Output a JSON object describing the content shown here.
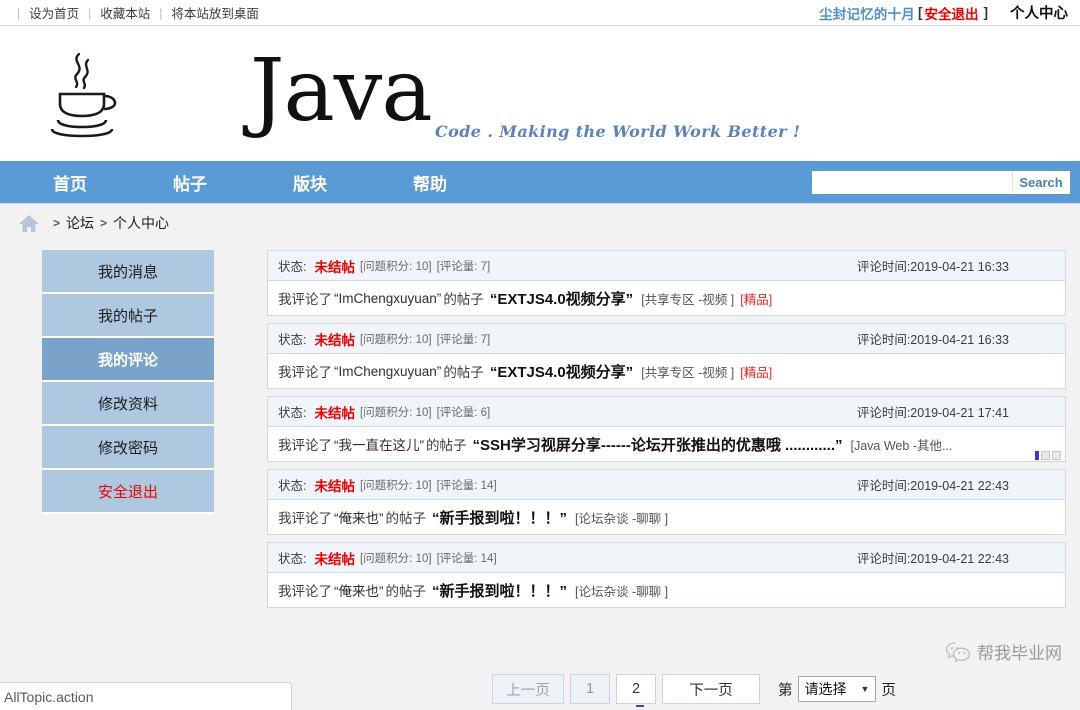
{
  "topbar": {
    "links": [
      "设为首页",
      "收藏本站",
      "将本站放到桌面"
    ],
    "separator": "|",
    "username": "尘封记忆的十月",
    "bracket_left": "[",
    "logout": "安全退出",
    "bracket_right": "]",
    "personal_center": "个人中心"
  },
  "banner": {
    "logo_text": "Java",
    "tagline": "Code . Making the World Work Better !"
  },
  "nav": {
    "items": [
      "首页",
      "帖子",
      "版块",
      "帮助"
    ],
    "search_value": "",
    "search_placeholder": "",
    "search_button": "Search",
    "bg_color": "#5b9bd5"
  },
  "breadcrumb": {
    "home_icon": "home-icon",
    "sep": ">",
    "items": [
      "论坛",
      "个人中心"
    ]
  },
  "sidebar": {
    "items": [
      {
        "label": "我的消息",
        "active": false,
        "danger": false
      },
      {
        "label": "我的帖子",
        "active": false,
        "danger": false
      },
      {
        "label": "我的评论",
        "active": true,
        "danger": false
      },
      {
        "label": "修改资料",
        "active": false,
        "danger": false
      },
      {
        "label": "修改密码",
        "active": false,
        "danger": false
      },
      {
        "label": "安全退出",
        "active": false,
        "danger": true
      }
    ],
    "bg_color": "#aec8e0",
    "active_color": "#7ba3c9",
    "danger_color": "#ee0000"
  },
  "comments": {
    "status_label": "状态:",
    "time_label": "评论时间:",
    "prefix": "我评论了",
    "mid": "的帖子",
    "rows": [
      {
        "status": "未结帖",
        "score": "[问题积分: 10]",
        "count": "[评论量: 7]",
        "time": "2019-04-21 16:33",
        "author": "“ImChengxuyuan”",
        "title": "“EXTJS4.0视频分享”",
        "board": "[共享专区 -视频 ]",
        "badge": "[精品]",
        "overflow": false
      },
      {
        "status": "未结帖",
        "score": "[问题积分: 10]",
        "count": "[评论量: 7]",
        "time": "2019-04-21 16:33",
        "author": "“ImChengxuyuan”",
        "title": "“EXTJS4.0视频分享”",
        "board": "[共享专区 -视频 ]",
        "badge": "[精品]",
        "overflow": false
      },
      {
        "status": "未结帖",
        "score": "[问题积分: 10]",
        "count": "[评论量: 6]",
        "time": "2019-04-21 17:41",
        "author": "“我一直在这儿”",
        "title": "“SSH学习视屏分享------论坛开张推出的优惠哦 ............”",
        "board": "[Java Web -其他...",
        "badge": "",
        "overflow": true
      },
      {
        "status": "未结帖",
        "score": "[问题积分: 10]",
        "count": "[评论量: 14]",
        "time": "2019-04-21 22:43",
        "author": "“俺来也”",
        "title": "“新手报到啦！！！”",
        "board": "[论坛杂谈 -聊聊 ]",
        "badge": "",
        "overflow": false
      },
      {
        "status": "未结帖",
        "score": "[问题积分: 10]",
        "count": "[评论量: 14]",
        "time": "2019-04-21 22:43",
        "author": "“俺来也”",
        "title": "“新手报到啦！！！”",
        "board": "[论坛杂谈 -聊聊 ]",
        "badge": "",
        "overflow": false
      }
    ]
  },
  "pager": {
    "prev": "上一页",
    "page_1": "1",
    "page_2": "2",
    "next": "下一页",
    "jump_prefix": "第",
    "select_value": "请选择",
    "caret": "▼",
    "jump_suffix": "页"
  },
  "watermark": {
    "text": "帮我毕业网",
    "icon": "wechat-icon",
    "url": "https://blog.csdn.net/qq_34417749"
  },
  "statusbar": {
    "text": "AllTopic.action"
  }
}
